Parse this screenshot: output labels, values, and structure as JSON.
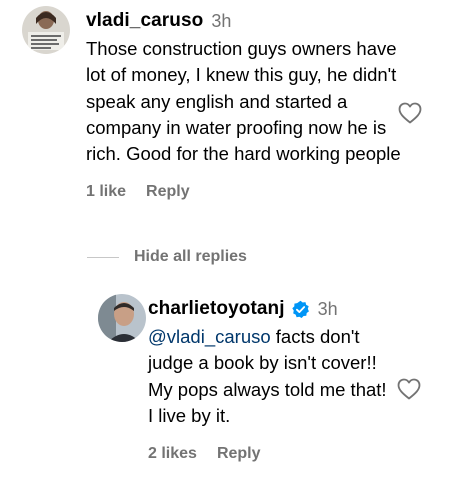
{
  "comment": {
    "username": "vladi_caruso",
    "time": "3h",
    "text": "Those construction guys owners have lot of money, I knew this guy, he didn't speak any english and started a company in water proofing now he is rich. Good for the hard working people",
    "likes": "1 like",
    "reply_label": "Reply",
    "avatar_icon": "portrait-avatar-icon",
    "like_icon": "heart-outline-icon"
  },
  "hide_replies_label": "Hide all replies",
  "reply": {
    "username": "charlietoyotanj",
    "verified_icon": "verified-badge-icon",
    "time": "3h",
    "mention": "@vladi_caruso",
    "text": " facts don't judge a book by isn't cover!! My pops always told me that! I live by it.",
    "likes": "2 likes",
    "reply_label": "Reply",
    "avatar_icon": "portrait-avatar-icon",
    "like_icon": "heart-outline-icon"
  },
  "colors": {
    "text": "#000000",
    "secondary": "#737373",
    "mention": "#00376b",
    "verified": "#0095f6"
  }
}
